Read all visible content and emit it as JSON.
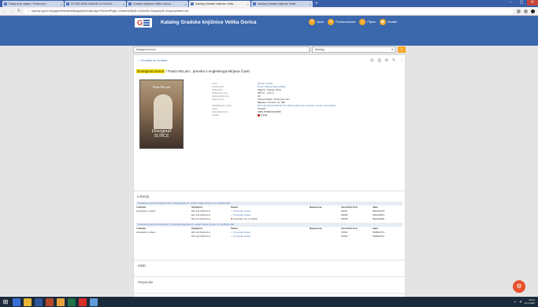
{
  "browser": {
    "tabs": [
      {
        "title": "Dodaj novu objavu ‹ Podrucne i...",
        "active": false
      },
      {
        "title": "DO ŽELJENE KNJIGE U 4 KLIKA!...",
        "active": false
      },
      {
        "title": "Gradska knjižnica Velika Gorica",
        "active": false
      },
      {
        "title": "Katalog Gradske knjižnice Veliki...",
        "active": true
      },
      {
        "title": "Katalog Gradske knjižnice Veliki...",
        "active": false
      }
    ],
    "new_tab": "+",
    "url": "opacvg.vgcm.hr/pages/Results/bibliographicData.aspx?RecordPage=1&searchByID=1&textID=0&queryID=2&queryIndex=0&...",
    "url_prefix": "ⓘ"
  },
  "site": {
    "title": "Katalog Gradske knjižnice Velika Gorica",
    "nav": [
      {
        "label": "Upute",
        "icon": "?"
      },
      {
        "label": "Podrška stranica",
        "icon": "✦"
      },
      {
        "label": "Prijava",
        "icon": "⌂"
      },
      {
        "label": "Hrvatski",
        "icon": "◉"
      }
    ],
    "search_value": "dosegnuti sunce",
    "search_field": "Autolog",
    "search_button": "⌕"
  },
  "record": {
    "back_label": "← Povratak na rezultate",
    "title_highlight": "Dosegnuti sunce",
    "title_rest": " / Paula McLain ; prevela s engleskoga Mirjana Čanić",
    "cover_author": "Paula McLain",
    "cover_title_1": "Dosegnuti",
    "cover_title_2": "SUNCE",
    "fields": [
      {
        "key": "Autor",
        "value": "McLain, Paula",
        "link": true
      },
      {
        "key": "Ostali autori",
        "value": "Čanić, Mirjana [prevoditelj]",
        "link": true
      },
      {
        "key": "Nakladnik",
        "value": "Zagreb : Znanje, 2019",
        "link": false
      },
      {
        "key": "Materijalni opis",
        "value": "385 str. ; 24 cm",
        "link": false
      },
      {
        "key": "Nakladnička cjel.",
        "value": "Hit",
        "link": false
      },
      {
        "key": "Napomena",
        "value": "Prijevod djela: Circling the Sun",
        "link": false
      },
      {
        "key": "",
        "value": "Bilješka o autorici: str. 385",
        "link": false
      },
      {
        "key": "Klasifikacija (UDK)",
        "value": "821.111(73)-31=163.42 Američka književnost. Romani, novele, pripovijetke",
        "link": true
      },
      {
        "key": "Jezik",
        "value": "hrvatski",
        "link": false
      },
      {
        "key": "Standardni broj",
        "value": "ISBN 9789532343655",
        "link": false
      },
      {
        "key": "Građa",
        "value": "Knjiga",
        "link": false,
        "icon": true
      }
    ]
  },
  "holdings": {
    "section_label": "Lokacija",
    "columns": [
      "Lokacija",
      "Signatura",
      "Status",
      "Napomena",
      "Inventarni broj",
      "Idem"
    ],
    "branches": [
      {
        "name": "Središnja knjižnica Velika Gorica, Zagrebačka 37, 10410 Velika Gorica, tel. 01/6222-949",
        "rows": [
          {
            "loc": "Za Iskazom prikaz",
            "sig": "821.111 MACLA d",
            "status": "Provjerite status",
            "ok": true,
            "inv": "96697",
            "id": "590108279"
          },
          {
            "loc": "",
            "sig": "821.111 MACLA d",
            "status": "Provjerite status",
            "ok": true,
            "inv": "96698",
            "id": "590108281"
          },
          {
            "loc": "",
            "sig": "821.111 MACLA d",
            "status": "Posuđeno do 1.6.2020",
            "ok": false,
            "inv": "96699",
            "id": "590108280"
          }
        ]
      },
      {
        "name": "Područna knjižnica Galženica, Trg Ruđera Raekića 5, 10410 Velika Gorica, tel. 01/6222-184",
        "rows": [
          {
            "loc": "Za Iskazom prikaz",
            "sig": "821.111 MACLA d",
            "status": "Provjerite status",
            "ok": true,
            "inv": "53350",
            "id": "590802753"
          },
          {
            "loc": "",
            "sig": "821.111 MACLA d",
            "status": "Provjerite status",
            "ok": true,
            "inv": "53351",
            "id": "590802754"
          }
        ]
      }
    ]
  },
  "sections": [
    "ISBD",
    "Preporuke",
    "Oznake | Tagovi"
  ],
  "fab_icon": "⚙",
  "taskbar": {
    "clock_time": "09:21",
    "clock_date": "24.4.2020"
  }
}
